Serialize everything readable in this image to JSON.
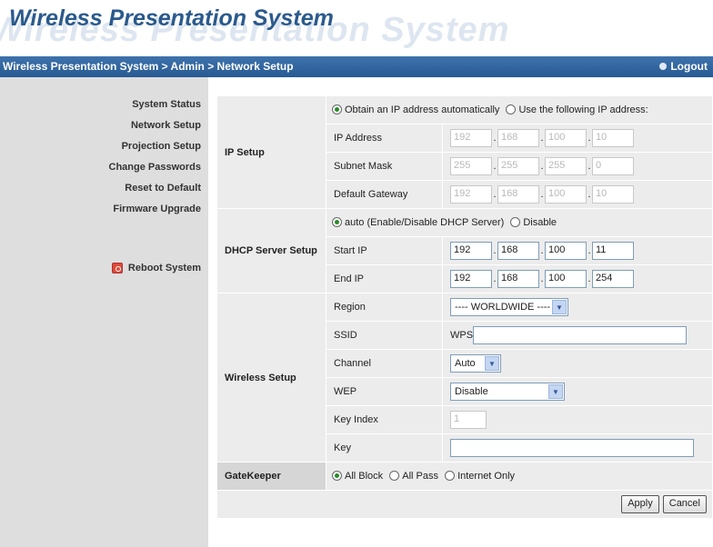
{
  "header": {
    "title": "Wireless Presentation System",
    "ghost": "Wireless Presentation System"
  },
  "breadcrumb": {
    "path": "Wireless Presentation System > Admin > Network Setup",
    "logout": "Logout"
  },
  "sidebar": {
    "items": [
      {
        "label": "System Status"
      },
      {
        "label": "Network Setup"
      },
      {
        "label": "Projection Setup"
      },
      {
        "label": "Change Passwords"
      },
      {
        "label": "Reset to Default"
      },
      {
        "label": "Firmware Upgrade"
      },
      {
        "label": "Reboot System"
      }
    ]
  },
  "ip_setup": {
    "section": "IP Setup",
    "opt_auto": "Obtain an IP address automatically",
    "opt_manual": "Use the following IP address:",
    "ip_label": "IP Address",
    "ip": [
      "192",
      "168",
      "100",
      "10"
    ],
    "mask_label": "Subnet Mask",
    "mask": [
      "255",
      "255",
      "255",
      "0"
    ],
    "gw_label": "Default Gateway",
    "gw": [
      "192",
      "168",
      "100",
      "10"
    ]
  },
  "dhcp": {
    "section": "DHCP Server Setup",
    "opt_auto": "auto (Enable/Disable DHCP Server)",
    "opt_disable": "Disable",
    "start_label": "Start IP",
    "start": [
      "192",
      "168",
      "100",
      "11"
    ],
    "end_label": "End IP",
    "end": [
      "192",
      "168",
      "100",
      "254"
    ]
  },
  "wireless": {
    "section": "Wireless Setup",
    "region_label": "Region",
    "region_value": "---- WORLDWIDE ----",
    "ssid_label": "SSID",
    "ssid_prefix": "WPS",
    "ssid_value": "",
    "channel_label": "Channel",
    "channel_value": "Auto",
    "wep_label": "WEP",
    "wep_value": "Disable",
    "keyindex_label": "Key Index",
    "keyindex_value": "1",
    "key_label": "Key",
    "key_value": ""
  },
  "gatekeeper": {
    "section": "GateKeeper",
    "opt_block": "All Block",
    "opt_pass": "All Pass",
    "opt_internet": "Internet Only"
  },
  "buttons": {
    "apply": "Apply",
    "cancel": "Cancel"
  }
}
